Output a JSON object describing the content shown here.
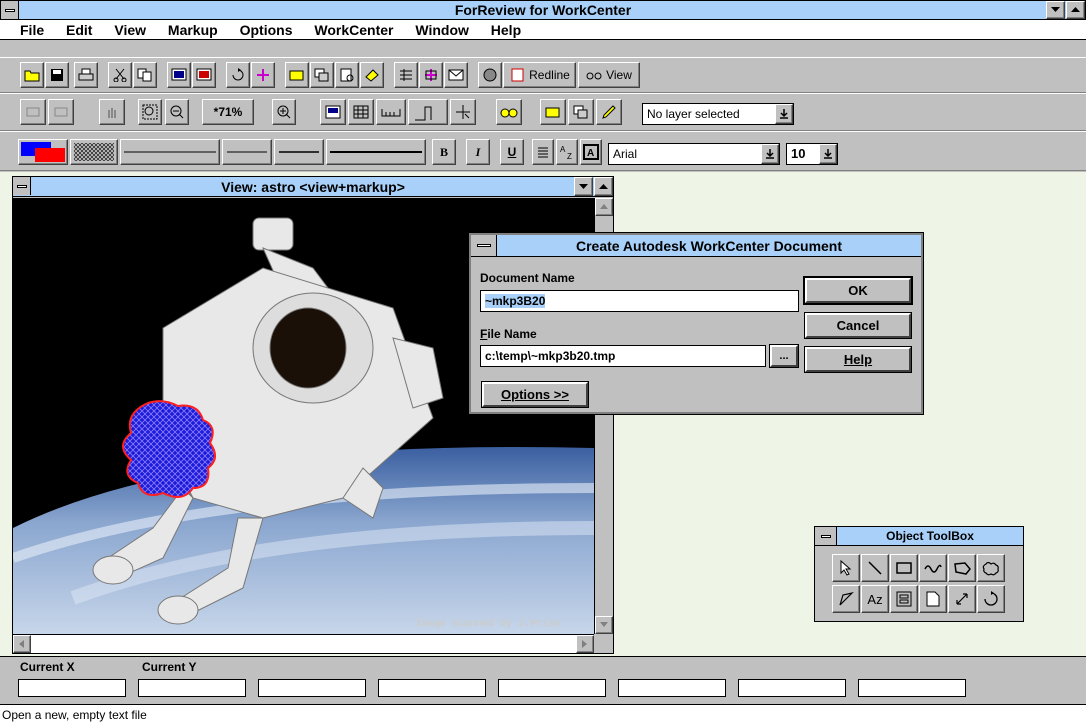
{
  "app": {
    "title": "ForReview for WorkCenter"
  },
  "menu": [
    {
      "label": "File"
    },
    {
      "label": "Edit"
    },
    {
      "label": "View"
    },
    {
      "label": "Markup"
    },
    {
      "label": "Options"
    },
    {
      "label": "WorkCenter"
    },
    {
      "label": "Window"
    },
    {
      "label": "Help"
    }
  ],
  "toolbar1": {
    "redline_label": "Redline",
    "view_label": "View"
  },
  "toolbar2": {
    "zoom_label": "*71%",
    "layer_select": "No layer selected"
  },
  "toolbar3": {
    "bold": "B",
    "italic": "I",
    "underline": "U",
    "font_select": "Arial",
    "size_select": "10"
  },
  "view_window": {
    "title": "View: astro <view+markup>",
    "caption": "Image scanned by J.Prise"
  },
  "dialog": {
    "title": "Create Autodesk WorkCenter Document",
    "doc_name_label": "Document Name",
    "doc_name_value": "~mkp3B20",
    "file_name_label": "File Name",
    "file_name_value": "c:\\temp\\~mkp3b20.tmp",
    "browse_label": "...",
    "ok_label": "OK",
    "cancel_label": "Cancel",
    "help_label": "Help",
    "options_label": "Options >>"
  },
  "toolbox": {
    "title": "Object ToolBox",
    "tools": [
      "arrow-icon",
      "line-icon",
      "rectangle-icon",
      "freehand-icon",
      "polygon-icon",
      "cloud-icon",
      "polyline-icon",
      "text-icon",
      "stamp-icon",
      "note-icon",
      "dimension-icon",
      "rotate-icon"
    ],
    "text_tool_label": "Az"
  },
  "coords": {
    "x_label": "Current X",
    "y_label": "Current Y"
  },
  "status": {
    "text": "Open a new, empty text file"
  }
}
